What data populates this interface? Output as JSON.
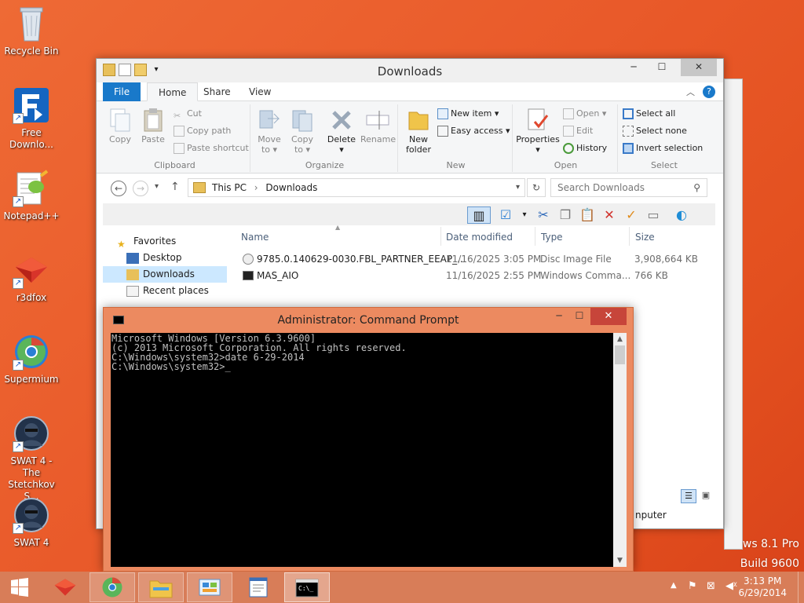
{
  "desktop": {
    "icons": [
      {
        "name": "Recycle Bin",
        "label_lines": [
          "Recycle Bin"
        ]
      },
      {
        "name": "Free Downloader",
        "label_lines": [
          "Free",
          "Downlo..."
        ]
      },
      {
        "name": "Notepad++",
        "label_lines": [
          "Notepad++"
        ]
      },
      {
        "name": "r3dfox",
        "label_lines": [
          "r3dfox"
        ]
      },
      {
        "name": "Supermium",
        "label_lines": [
          "Supermium"
        ]
      },
      {
        "name": "SWAT 4 - The Stetchkov Syndicate",
        "label_lines": [
          "SWAT 4 - The",
          "Stetchkov S..."
        ]
      },
      {
        "name": "SWAT 4",
        "label_lines": [
          "SWAT 4"
        ]
      }
    ],
    "watermark_line1": "ows 8.1 Pro",
    "watermark_line2": "Build 9600"
  },
  "explorer": {
    "title": "Downloads",
    "tabs": {
      "file": "File",
      "home": "Home",
      "share": "Share",
      "view": "View"
    },
    "ribbon": {
      "clipboard": {
        "copy": "Copy",
        "paste": "Paste",
        "cut": "Cut",
        "copy_path": "Copy path",
        "paste_shortcut": "Paste shortcut",
        "group": "Clipboard"
      },
      "organize": {
        "move_to": "Move",
        "move_to2": "to",
        "copy_to": "Copy",
        "copy_to2": "to",
        "delete": "Delete",
        "rename": "Rename",
        "group": "Organize"
      },
      "new": {
        "new_folder": "New",
        "new_folder2": "folder",
        "new_item": "New item",
        "easy_access": "Easy access",
        "group": "New"
      },
      "open": {
        "properties": "Properties",
        "open": "Open",
        "edit": "Edit",
        "history": "History",
        "group": "Open"
      },
      "select": {
        "select_all": "Select all",
        "select_none": "Select none",
        "invert": "Invert selection",
        "group": "Select"
      }
    },
    "address": {
      "path_root": "This PC",
      "sep": "›",
      "path_leaf": "Downloads",
      "search_placeholder": "Search Downloads"
    },
    "nav": {
      "favorites": "Favorites",
      "items": [
        "Desktop",
        "Downloads",
        "Recent places"
      ]
    },
    "columns": {
      "name": "Name",
      "date": "Date modified",
      "type": "Type",
      "size": "Size"
    },
    "files": [
      {
        "name": "9785.0.140629-0030.FBL_PARTNER_EEAP_...",
        "date": "11/16/2025 3:05 PM",
        "type": "Disc Image File",
        "size": "3,908,664 KB"
      },
      {
        "name": "MAS_AIO",
        "date": "11/16/2025 2:55 PM",
        "type": "Windows Comma...",
        "size": "766 KB"
      }
    ],
    "partial_text": "nputer"
  },
  "cmd": {
    "title": "Administrator: Command Prompt",
    "lines": [
      "Microsoft Windows [Version 6.3.9600]",
      "(c) 2013 Microsoft Corporation. All rights reserved.",
      "",
      "C:\\Windows\\system32>date 6-29-2014",
      "",
      "C:\\Windows\\system32>_"
    ]
  },
  "taskbar": {
    "clock_time": "3:13 PM",
    "clock_date": "6/29/2014"
  },
  "colors": {
    "accent": "#1979ca",
    "desktop": "#e95a2a",
    "cmd_frame": "#ec8a60",
    "taskbar": "#d87d58"
  }
}
